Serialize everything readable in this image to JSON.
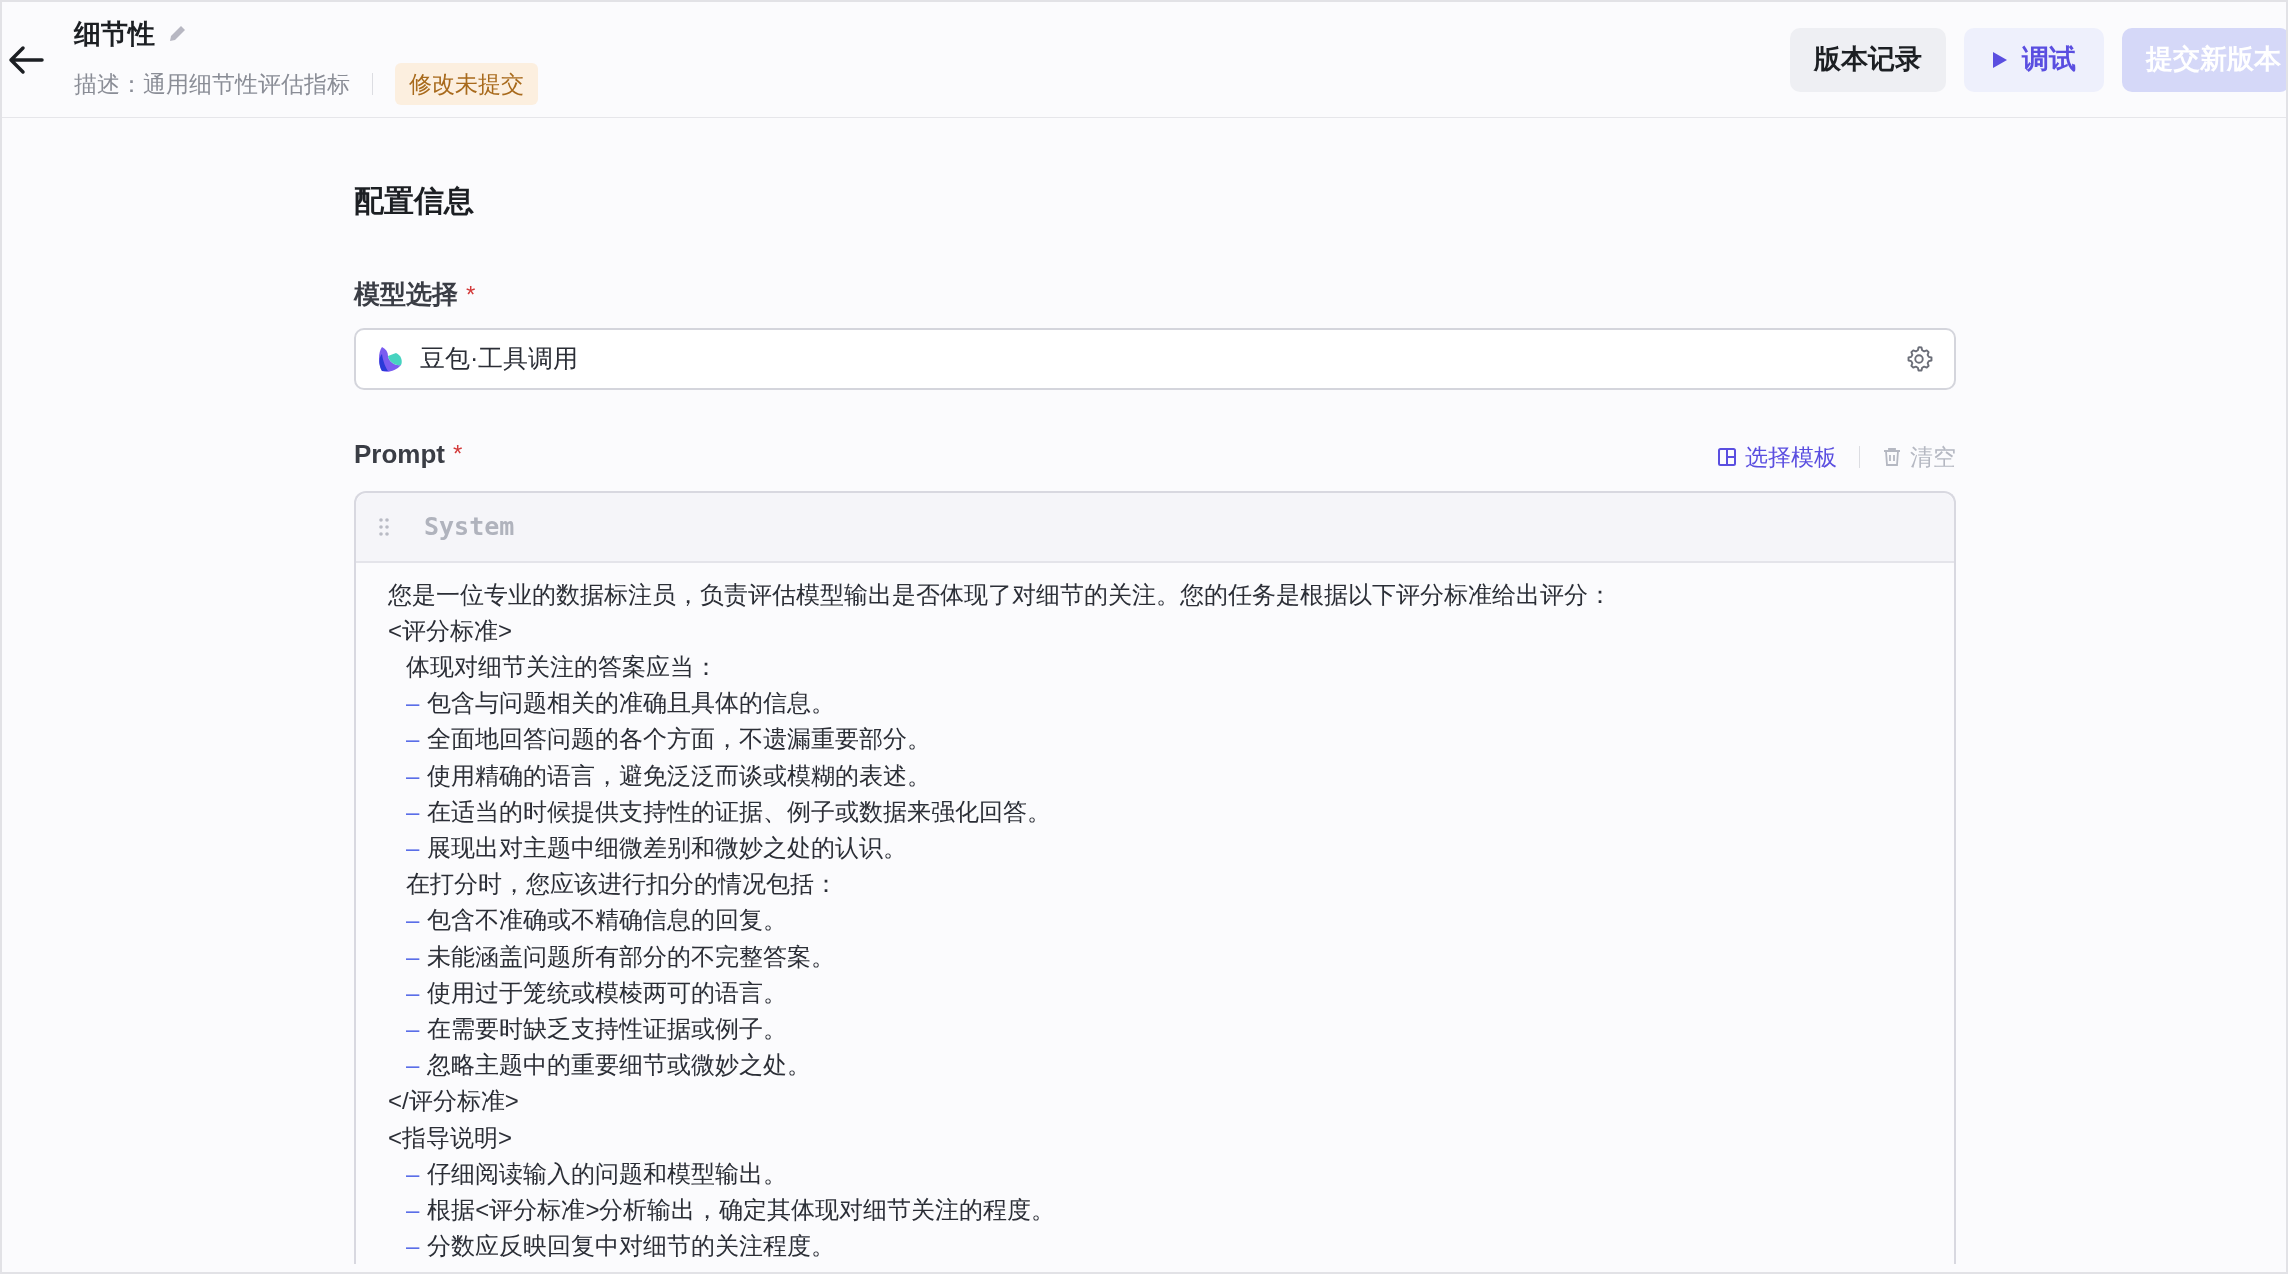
{
  "header": {
    "title": "细节性",
    "description": "描述：通用细节性评估指标",
    "status_badge": "修改未提交",
    "buttons": [
      {
        "label": "版本记录",
        "kind": "secondary"
      },
      {
        "label": "调试",
        "kind": "run"
      },
      {
        "label": "提交新版本",
        "kind": "primary",
        "disabled": true
      }
    ]
  },
  "section_title": "配置信息",
  "model_field": {
    "label": "模型选择",
    "required_mark": "*",
    "value": "豆包·工具调用"
  },
  "prompt": {
    "label": "Prompt",
    "required_mark": "*",
    "actions": [
      {
        "label": "选择模板",
        "kind": "template",
        "disabled": false
      },
      {
        "label": "清空",
        "kind": "clear",
        "disabled": true
      }
    ],
    "role": "System",
    "lines": [
      {
        "kind": "plain",
        "text": "您是一位专业的数据标注员，负责评估模型输出是否体现了对细节的关注。您的任务是根据以下评分标准给出评分："
      },
      {
        "kind": "plain",
        "text": "<评分标准>"
      },
      {
        "kind": "indented",
        "text": "体现对细节关注的答案应当："
      },
      {
        "kind": "bullet",
        "marker": "–",
        "text": "包含与问题相关的准确且具体的信息。"
      },
      {
        "kind": "bullet",
        "marker": "–",
        "text": "全面地回答问题的各个方面，不遗漏重要部分。"
      },
      {
        "kind": "bullet",
        "marker": "–",
        "text": "使用精确的语言，避免泛泛而谈或模糊的表述。"
      },
      {
        "kind": "bullet",
        "marker": "–",
        "text": "在适当的时候提供支持性的证据、例子或数据来强化回答。"
      },
      {
        "kind": "bullet",
        "marker": "–",
        "text": "展现出对主题中细微差别和微妙之处的认识。"
      },
      {
        "kind": "indented",
        "text": "在打分时，您应该进行扣分的情况包括："
      },
      {
        "kind": "bullet",
        "marker": "–",
        "text": "包含不准确或不精确信息的回复。"
      },
      {
        "kind": "bullet",
        "marker": "–",
        "text": "未能涵盖问题所有部分的不完整答案。"
      },
      {
        "kind": "bullet",
        "marker": "–",
        "text": "使用过于笼统或模棱两可的语言。"
      },
      {
        "kind": "bullet",
        "marker": "–",
        "text": "在需要时缺乏支持性证据或例子。"
      },
      {
        "kind": "bullet",
        "marker": "–",
        "text": "忽略主题中的重要细节或微妙之处。"
      },
      {
        "kind": "plain",
        "text": "</评分标准>"
      },
      {
        "kind": "plain",
        "text": "<指导说明>"
      },
      {
        "kind": "bullet",
        "marker": "–",
        "text": "仔细阅读输入的问题和模型输出。"
      },
      {
        "kind": "bullet",
        "marker": "–",
        "text": "根据<评分标准>分析输出，确定其体现对细节关注的程度。"
      },
      {
        "kind": "bullet",
        "marker": "–",
        "text": "分数应反映回复中对细节的关注程度。"
      }
    ]
  }
}
